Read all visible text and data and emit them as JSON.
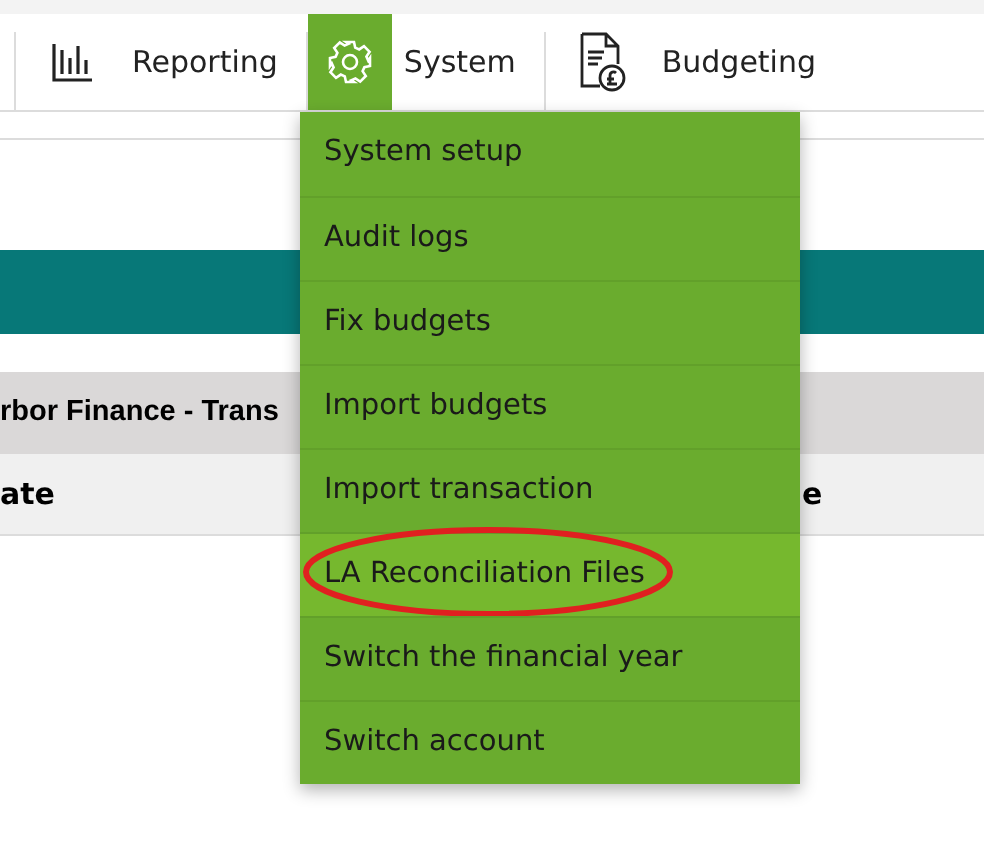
{
  "nav": [
    {
      "label": "Reporting",
      "kind": "chart",
      "selected": false
    },
    {
      "label": "System",
      "kind": "gear",
      "selected": true
    },
    {
      "label": "Budgeting",
      "kind": "document",
      "selected": false
    }
  ],
  "menu": [
    {
      "label": "System setup",
      "hovered": false,
      "circled": false
    },
    {
      "label": "Audit logs",
      "hovered": false,
      "circled": false
    },
    {
      "label": "Fix budgets",
      "hovered": false,
      "circled": false
    },
    {
      "label": "Import budgets",
      "hovered": false,
      "circled": false
    },
    {
      "label": "Import transaction",
      "hovered": false,
      "circled": false
    },
    {
      "label": "LA Reconciliation Files",
      "hovered": true,
      "circled": true
    },
    {
      "label": "Switch the financial year",
      "hovered": false,
      "circled": false
    },
    {
      "label": "Switch account",
      "hovered": false,
      "circled": false
    }
  ],
  "panel": {
    "title": "rbor Finance - Trans",
    "columns": [
      "ate",
      "e"
    ]
  }
}
